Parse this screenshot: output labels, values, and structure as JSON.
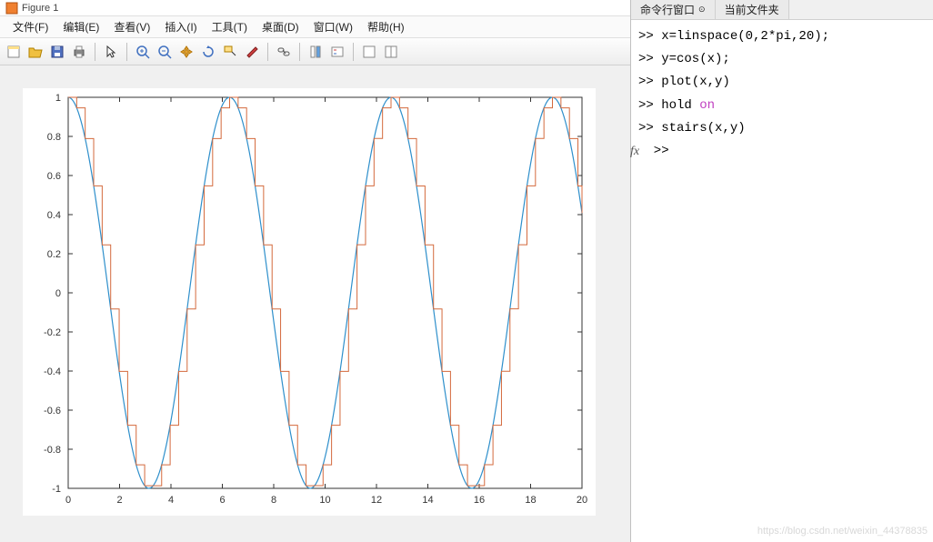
{
  "window": {
    "title": "Figure 1"
  },
  "menu": {
    "file": "文件(F)",
    "edit": "编辑(E)",
    "view": "查看(V)",
    "insert": "插入(I)",
    "tools": "工具(T)",
    "desktop": "桌面(D)",
    "window": "窗口(W)",
    "help": "帮助(H)"
  },
  "side": {
    "tab_command": "命令行窗口",
    "tab_folder": "当前文件夹"
  },
  "commands": [
    "x=linspace(0,2*pi,20);",
    "y=cos(x);",
    "plot(x,y)",
    "hold on",
    "stairs(x,y)"
  ],
  "prompt": ">> ",
  "watermark": "https://blog.csdn.net/weixin_44378835",
  "chart_data": {
    "type": "line",
    "title": "",
    "xlabel": "",
    "ylabel": "",
    "xlim": [
      0,
      20
    ],
    "ylim": [
      -1,
      1
    ],
    "xticks": [
      0,
      2,
      4,
      6,
      8,
      10,
      12,
      14,
      16,
      18,
      20
    ],
    "yticks": [
      -1,
      -0.8,
      -0.6,
      -0.4,
      -0.2,
      0,
      0.2,
      0.4,
      0.6,
      0.8,
      1
    ],
    "xstep": 0.3307,
    "series": [
      {
        "name": "plot(x,y)",
        "kind": "line",
        "color": "#2e8fcb",
        "y_fn": "cos(x)"
      },
      {
        "name": "stairs(x,y)",
        "kind": "stairs",
        "color": "#d46a3d",
        "y_fn": "cos(x)"
      }
    ]
  }
}
